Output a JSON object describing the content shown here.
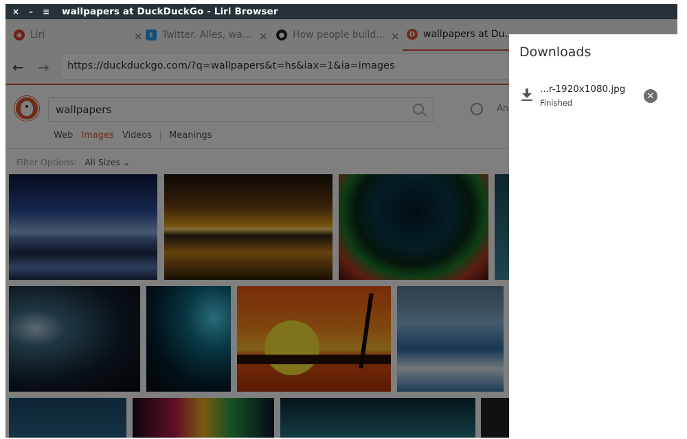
{
  "window": {
    "title": "wallpapers at DuckDuckGo - Liri Browser",
    "close_glyph": "×",
    "minimize_glyph": "–",
    "menu_glyph": "≡"
  },
  "tabs": [
    {
      "label": "Liri",
      "favicon": "liri-icon"
    },
    {
      "label": "Twitter. Alles, wa...",
      "favicon": "twitter-icon"
    },
    {
      "label": "How people build...",
      "favicon": "github-icon"
    },
    {
      "label": "wallpapers at Du...",
      "favicon": "duckduckgo-icon"
    }
  ],
  "tab_close_glyph": "×",
  "nav": {
    "back": "←",
    "forward": "→"
  },
  "url": "https://duckduckgo.com/?q=wallpapers&t=hs&iax=1&ia=images",
  "search": {
    "query": "wallpapers",
    "region_partial": "Any"
  },
  "verticals": {
    "web": "Web",
    "images": "Images",
    "videos": "Videos",
    "meanings": "Meanings"
  },
  "filter": {
    "label": "Filter Options:",
    "size": "All Sizes",
    "chevron": "⌄"
  },
  "downloads": {
    "title": "Downloads",
    "items": [
      {
        "name": "...r-1920x1080.jpg",
        "status": "Finished",
        "cancel_glyph": "✕"
      }
    ]
  },
  "colors": {
    "titlebar": "#263238",
    "accent": "#de5833",
    "overlay": "rgba(0,0,0,0.5)"
  }
}
